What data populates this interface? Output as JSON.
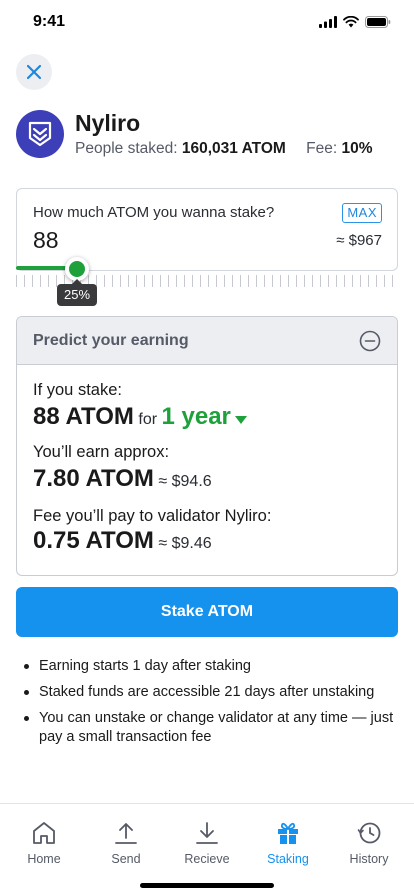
{
  "status_bar": {
    "time": "9:41"
  },
  "validator": {
    "name": "Nyliro",
    "people_staked_label": "People staked:",
    "people_staked_value": "160,031 ATOM",
    "fee_label": "Fee:",
    "fee_value": "10%"
  },
  "amount": {
    "label": "How much ATOM you wanna stake?",
    "max_label": "MAX",
    "value": "88",
    "fiat": "≈ $967"
  },
  "slider": {
    "percent": 25,
    "tooltip": "25%"
  },
  "predict": {
    "title": "Predict your earning",
    "if_stake_label": "If you stake:",
    "stake_amount": "88 ATOM",
    "for_label": "for",
    "period": "1 year",
    "earn_label": "You’ll earn approx:",
    "earn_amount": "7.80 ATOM",
    "earn_fiat": "≈ $94.6",
    "fee_label": "Fee you’ll pay to validator Nyliro:",
    "fee_amount": "0.75 ATOM",
    "fee_fiat": "≈ $9.46"
  },
  "stake_button": "Stake ATOM",
  "notes": [
    "Earning starts 1 day after staking",
    "Staked funds are accessible 21 days after unstaking",
    "You can unstake or change validator at any time — just pay a small transaction fee"
  ],
  "tabbar": {
    "tabs": [
      {
        "label": "Home",
        "icon": "home-icon"
      },
      {
        "label": "Send",
        "icon": "send-icon"
      },
      {
        "label": "Recieve",
        "icon": "receive-icon"
      },
      {
        "label": "Staking",
        "icon": "gift-icon",
        "active": true
      },
      {
        "label": "History",
        "icon": "history-icon"
      }
    ]
  },
  "colors": {
    "accent": "#1591EE",
    "green": "#1EA13A",
    "validator_logo": "#3D3FB8"
  }
}
